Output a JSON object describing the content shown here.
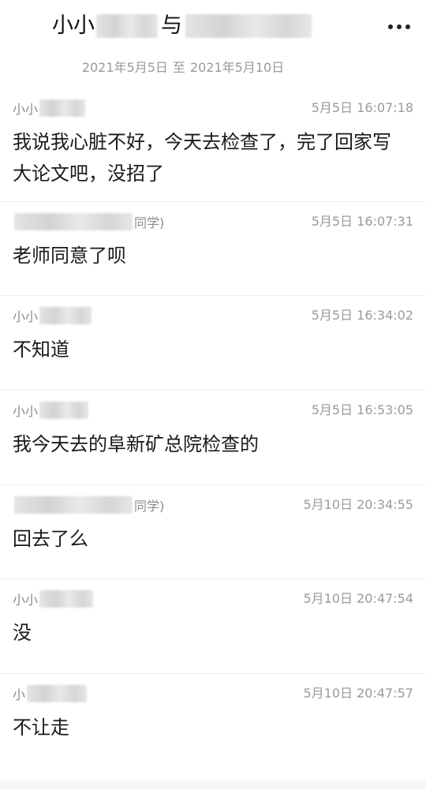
{
  "header": {
    "title_prefix": "小小",
    "title_middle": "与",
    "more_icon": "more-horizontal-icon"
  },
  "date_range": {
    "start": "2021年5月5日",
    "separator": "至",
    "end": "2021年5月10日"
  },
  "messages": [
    {
      "sender": "小小",
      "sender_suffix": "",
      "time": "5月5日 16:07:18",
      "text": "我说我心脏不好，今天去检查了，完了回家写大论文吧，没招了"
    },
    {
      "sender": "",
      "sender_suffix": "同学)",
      "time": "5月5日 16:07:31",
      "text": "老师同意了呗"
    },
    {
      "sender": "小小",
      "sender_suffix": "",
      "time": "5月5日 16:34:02",
      "text": "不知道"
    },
    {
      "sender": "小小",
      "sender_suffix": "",
      "time": "5月5日 16:53:05",
      "text": "我今天去的阜新矿总院检查的"
    },
    {
      "sender": "",
      "sender_suffix": "同学)",
      "time": "5月10日 20:34:55",
      "text": "回去了么"
    },
    {
      "sender": "小小",
      "sender_suffix": "",
      "time": "5月10日 20:47:54",
      "text": "没"
    },
    {
      "sender": "小",
      "sender_suffix": "",
      "time": "5月10日 20:47:57",
      "text": "不让走"
    }
  ]
}
